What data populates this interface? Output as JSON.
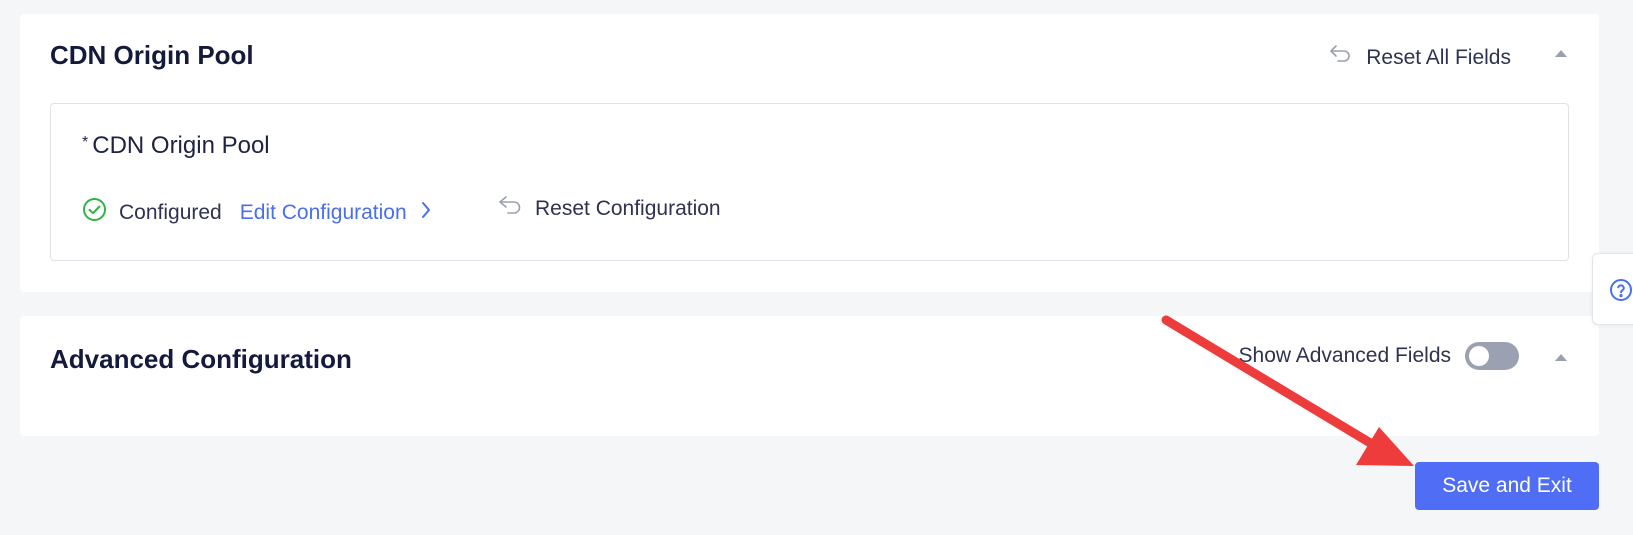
{
  "origin_section": {
    "title": "CDN Origin Pool",
    "reset_all_label": "Reset All Fields",
    "reset_icon": "undo-arrow-icon",
    "collapse_icon": "chevron-up-icon",
    "field": {
      "required_mark": "*",
      "label": "CDN Origin Pool",
      "status_icon": "check-circle-icon",
      "status": "Configured",
      "edit_label": "Edit Configuration",
      "edit_icon": "chevron-right-icon",
      "reset_label": "Reset Configuration"
    }
  },
  "advanced_section": {
    "title": "Advanced Configuration",
    "toggle_label": "Show Advanced Fields",
    "toggle_on": false,
    "collapse_icon": "chevron-up-icon"
  },
  "actions": {
    "save_label": "Save and Exit"
  },
  "help": {
    "icon": "help-circle-icon"
  },
  "annotation": {
    "icon": "red-arrow-icon",
    "color": "#ee3b3b"
  },
  "colors": {
    "accent": "#4f6df5",
    "link": "#4a6ef0",
    "success": "#2fb344",
    "title": "#141a3c",
    "background": "#f5f6f8"
  }
}
